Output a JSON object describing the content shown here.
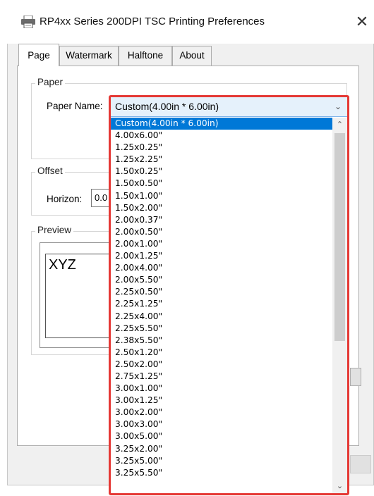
{
  "window": {
    "title": "RP4xx Series 200DPI TSC Printing Preferences",
    "close_glyph": "✕"
  },
  "tabs": [
    {
      "label": "Page",
      "active": true
    },
    {
      "label": "Watermark"
    },
    {
      "label": "Halftone"
    },
    {
      "label": "About"
    }
  ],
  "paper": {
    "group_label": "Paper",
    "name_label": "Paper Name:",
    "selected": "Custom(4.00in * 6.00in)"
  },
  "offset": {
    "group_label": "Offset",
    "horizon_label": "Horizon:",
    "horizon_value": "0.0"
  },
  "preview": {
    "group_label": "Preview",
    "sample_text": "XYZ"
  },
  "dropdown": {
    "options": [
      "Custom(4.00in * 6.00in)",
      "4.00x6.00\"",
      "1.25x0.25\"",
      "1.25x2.25\"",
      "1.50x0.25\"",
      "1.50x0.50\"",
      "1.50x1.00\"",
      "1.50x2.00\"",
      "2.00x0.37\"",
      "2.00x0.50\"",
      "2.00x1.00\"",
      "2.00x1.25\"",
      "2.00x4.00\"",
      "2.00x5.50\"",
      "2.25x0.50\"",
      "2.25x1.25\"",
      "2.25x4.00\"",
      "2.25x5.50\"",
      "2.38x5.50\"",
      "2.50x1.20\"",
      "2.50x2.00\"",
      "2.75x1.25\"",
      "3.00x1.00\"",
      "3.00x1.25\"",
      "3.00x2.00\"",
      "3.00x3.00\"",
      "3.00x5.00\"",
      "3.25x2.00\"",
      "3.25x5.00\"",
      "3.25x5.50\""
    ],
    "selected_index": 0
  },
  "colors": {
    "selection": "#0078d7",
    "highlight_outline": "#e53935"
  }
}
